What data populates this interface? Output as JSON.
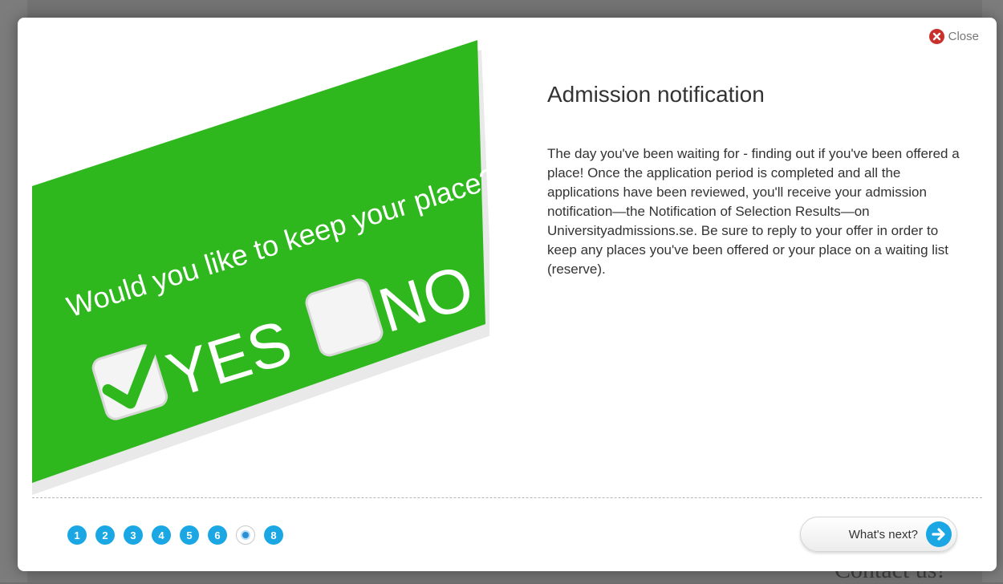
{
  "modal": {
    "close_label": "Close",
    "title": "Admission notification",
    "body": "The day you've been waiting for - finding out if you've been offered a place! Once the application period is completed and all the applications have been reviewed, you'll receive your admission notification—the Notification of Selection Results—on Universityadmissions.se. Be sure to reply to your offer in order to keep any places you've been offered or your place on a waiting list (reserve).",
    "image": {
      "question": "Would you like to keep your place?",
      "yes_label": "YES",
      "no_label": "NO",
      "background_color": "#2fb81e"
    },
    "pagination": {
      "pages": [
        "1",
        "2",
        "3",
        "4",
        "5",
        "6",
        "7",
        "8"
      ],
      "current_page": 7
    },
    "next_label": "What's next?"
  },
  "background_page": {
    "contact_label": "Contact us!"
  },
  "colors": {
    "accent": "#1aa7e4",
    "close": "#c9302c",
    "overlay": "#737373"
  }
}
